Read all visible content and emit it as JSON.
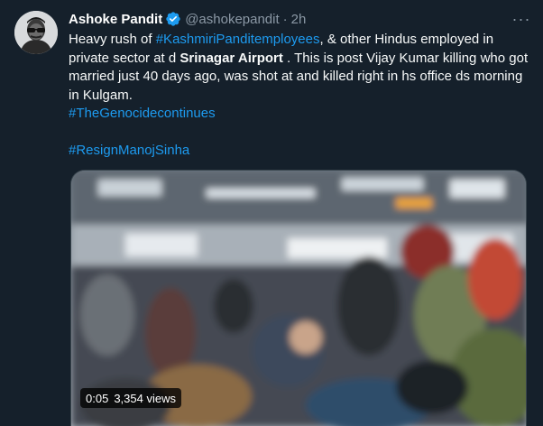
{
  "tweet": {
    "author_name": "Ashoke Pandit",
    "handle": "@ashokepandit",
    "separator": "·",
    "time": "2h",
    "more_label": "···",
    "text": {
      "p1_a": "Heavy rush of ",
      "p1_tag": "#KashmiriPanditemployees",
      "p1_b": ", & other Hindus employed in private sector at d ",
      "p1_bold": "Srinagar Airport",
      "p1_c": " . This is post Vijay Kumar killing who got married just 40 days ago,  was shot at and killed right in hs office ds morning in Kulgam.",
      "tag2": "#TheGenocidecontinues",
      "tag3": "#ResignManojSinha"
    },
    "video": {
      "duration": "0:05",
      "views": "3,354 views"
    }
  },
  "colors": {
    "background": "#15202b",
    "link": "#1d9bf0",
    "secondary_text": "#8b98a5",
    "verified": "#1d9bf0"
  },
  "icons": {
    "verified": "verified-badge-icon",
    "more": "more-horizontal-icon"
  }
}
